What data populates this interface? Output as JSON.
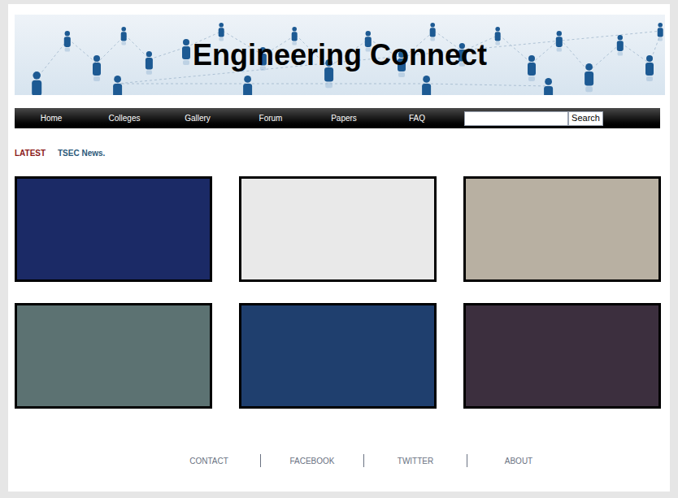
{
  "header": {
    "title": "Engineering Connect"
  },
  "nav": {
    "items": [
      {
        "label": "Home",
        "selected": false
      },
      {
        "label": "Colleges",
        "selected": false
      },
      {
        "label": "Gallery",
        "selected": false
      },
      {
        "label": "Forum",
        "selected": false
      },
      {
        "label": "Papers",
        "selected": false
      },
      {
        "label": "FAQ",
        "selected": false
      }
    ]
  },
  "search": {
    "value": "",
    "button": "Search"
  },
  "latest": {
    "label": "LATEST",
    "news": "TSEC News."
  },
  "footer": {
    "links": [
      "CONTACT",
      "FACEBOOK",
      "TWITTER",
      "ABOUT"
    ]
  }
}
